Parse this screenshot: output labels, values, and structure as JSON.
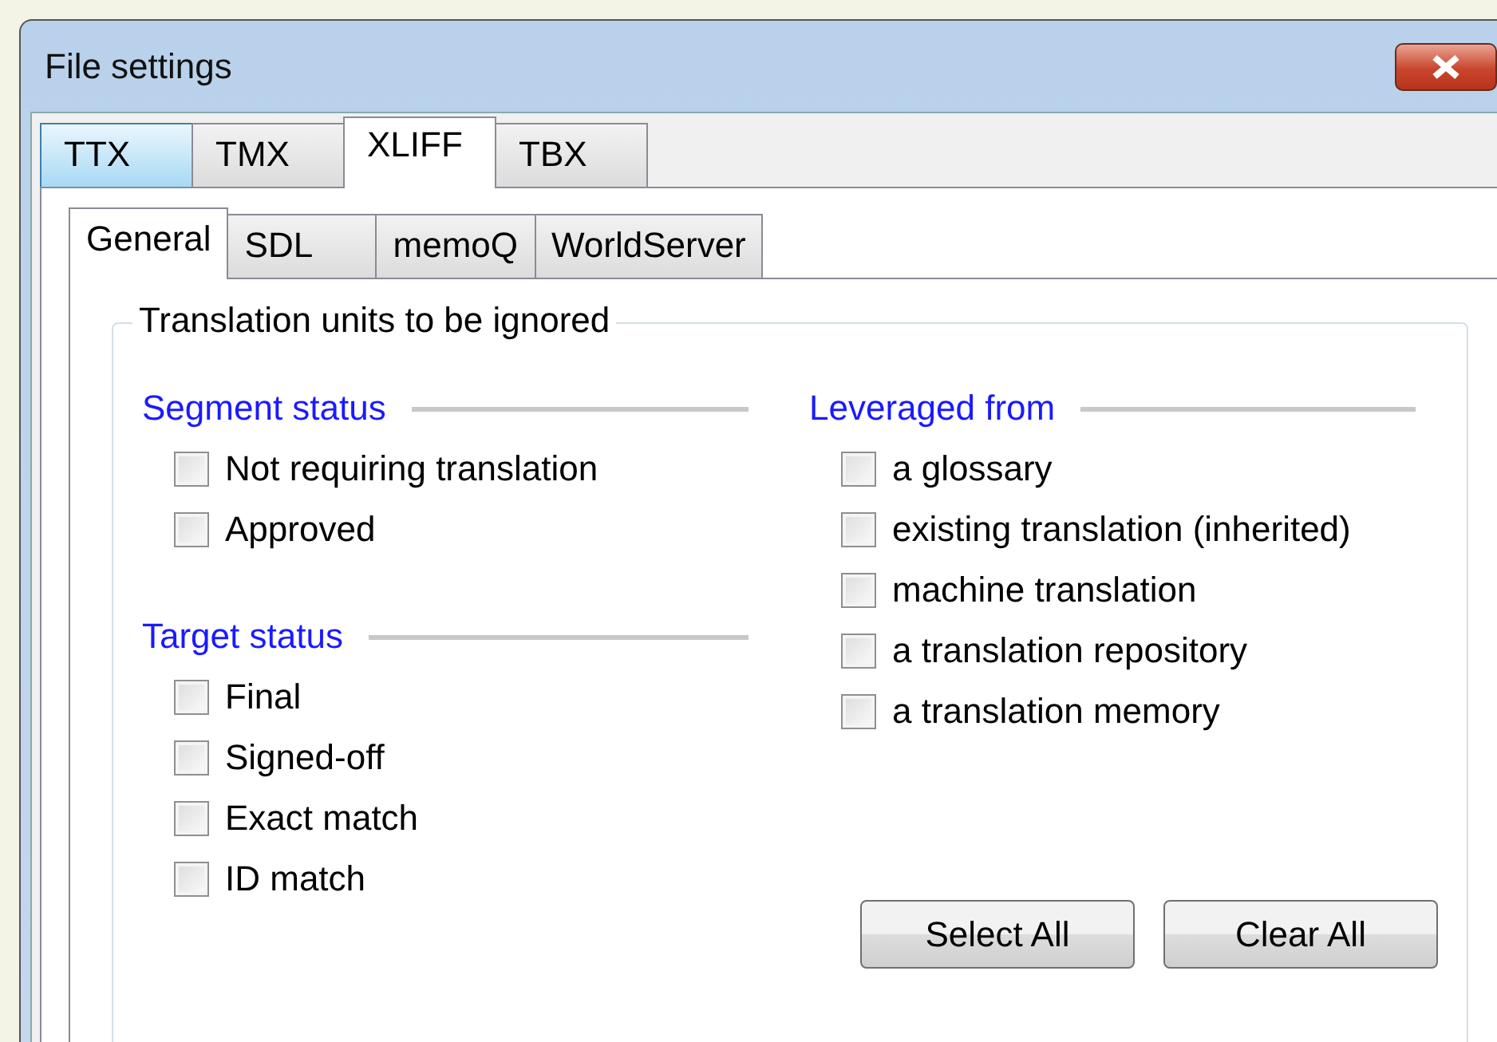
{
  "window": {
    "title": "File settings"
  },
  "tabs": [
    {
      "label": "TTX",
      "selected": false,
      "hovered": true
    },
    {
      "label": "TMX",
      "selected": false,
      "hovered": false
    },
    {
      "label": "XLIFF",
      "selected": true,
      "hovered": false
    },
    {
      "label": "TBX",
      "selected": false,
      "hovered": false
    }
  ],
  "subtabs": [
    {
      "label": "General",
      "selected": true
    },
    {
      "label": "SDL",
      "selected": false
    },
    {
      "label": "memoQ",
      "selected": false
    },
    {
      "label": "WorldServer",
      "selected": false
    }
  ],
  "group": {
    "title": "Translation units to be ignored",
    "columns": [
      {
        "sections": [
          {
            "heading": "Segment status",
            "options": [
              {
                "label": "Not requiring translation",
                "checked": false
              },
              {
                "label": "Approved",
                "checked": false
              }
            ]
          },
          {
            "heading": "Target status",
            "options": [
              {
                "label": "Final",
                "checked": false
              },
              {
                "label": "Signed-off",
                "checked": false
              },
              {
                "label": "Exact match",
                "checked": false
              },
              {
                "label": "ID match",
                "checked": false
              }
            ]
          }
        ]
      },
      {
        "sections": [
          {
            "heading": "Leveraged from",
            "options": [
              {
                "label": "a glossary",
                "checked": false
              },
              {
                "label": "existing translation (inherited)",
                "checked": false
              },
              {
                "label": "machine translation",
                "checked": false
              },
              {
                "label": "a translation repository",
                "checked": false
              },
              {
                "label": "a translation memory",
                "checked": false
              }
            ]
          }
        ]
      }
    ]
  },
  "buttons": [
    "Select All",
    "Clear All"
  ]
}
